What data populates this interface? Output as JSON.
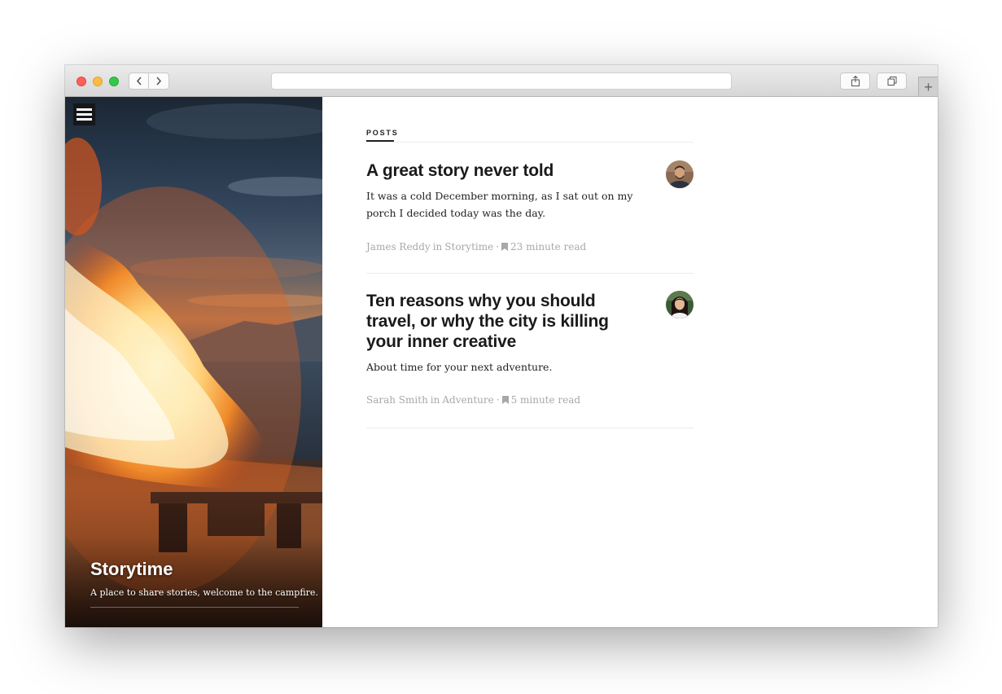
{
  "browser": {
    "url": ""
  },
  "blog": {
    "title": "Storytime",
    "description": "A place to share stories, welcome to the campfire."
  },
  "section": {
    "label": "POSTS"
  },
  "posts": [
    {
      "title": "A great story never told",
      "excerpt": "It was a cold December morning, as I sat out on my porch I decided today was the day.",
      "author": "James Reddy",
      "in": "in",
      "tag": "Storytime",
      "separator": "·",
      "read_time": "23 minute read"
    },
    {
      "title": "Ten reasons why you should travel, or why the city is killing your inner creative",
      "excerpt": "About time for your next adventure.",
      "author": "Sarah Smith",
      "in": "in",
      "tag": "Adventure",
      "separator": "·",
      "read_time": "5 minute read"
    }
  ],
  "colors": {
    "title_text": "#1a1a1a",
    "meta_text": "#a8a8a8",
    "close": "#fc605b",
    "minimize": "#fdbc40",
    "maximize": "#34c84a"
  },
  "icons": {
    "menu": "hamburger-menu-icon",
    "bookmark": "bookmark-icon",
    "share": "share-icon",
    "tabs": "tabs-overview-icon",
    "back": "chevron-left-icon",
    "forward": "chevron-right-icon",
    "new_tab": "plus-icon"
  }
}
